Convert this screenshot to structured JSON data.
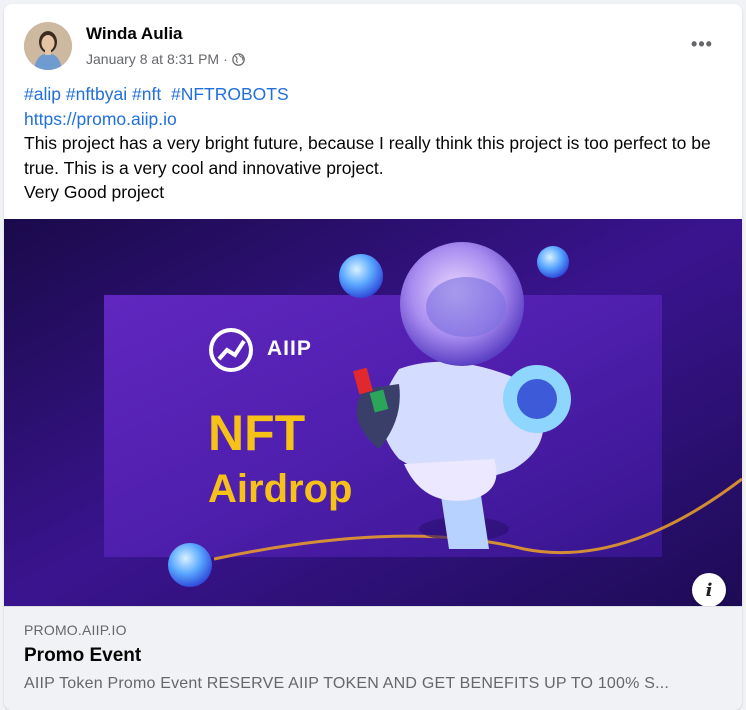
{
  "post": {
    "author": "Winda Aulia",
    "timestamp": "January 8 at 8:31 PM",
    "separator": "·",
    "privacy_icon": "globe-icon",
    "more_label": "•••",
    "hashtags": [
      "#alip",
      "#nftbyai",
      "#nft",
      " #NFTROBOTS"
    ],
    "link": "https://promo.aiip.io",
    "text_line1": "This project has a very bright future, because I really think this project is too perfect to be true. This is a very cool and innovative project.",
    "text_line2": "Very Good project"
  },
  "media": {
    "brand": "AIIP",
    "headline_1": "NFT",
    "headline_2": "Airdrop",
    "info_label": "i"
  },
  "link_preview": {
    "domain": "PROMO.AIIP.IO",
    "title": "Promo Event",
    "description": "AIIP Token Promo Event RESERVE AIIP TOKEN AND GET BENEFITS UP TO 100% S..."
  },
  "colors": {
    "link": "#216fdb",
    "headline_yellow": "#f7c218",
    "media_bg": "#210a57"
  }
}
